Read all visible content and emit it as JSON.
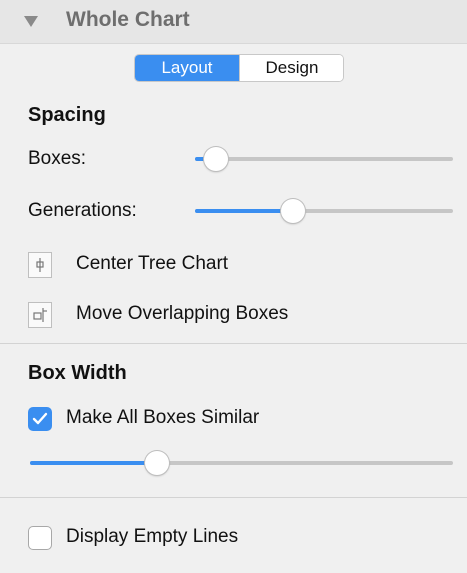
{
  "panel": {
    "title": "Whole Chart",
    "tabs": [
      {
        "label": "Layout",
        "active": true
      },
      {
        "label": "Design",
        "active": false
      }
    ]
  },
  "spacing": {
    "title": "Spacing",
    "boxes_label": "Boxes:",
    "boxes_value": 0.08,
    "generations_label": "Generations:",
    "generations_value": 0.38,
    "center_tree_label": "Center Tree Chart",
    "move_overlapping_label": "Move Overlapping Boxes"
  },
  "box_width": {
    "title": "Box Width",
    "make_similar_label": "Make All Boxes Similar",
    "make_similar_checked": true,
    "width_value": 0.3
  },
  "display_empty_lines": {
    "label": "Display Empty Lines",
    "checked": false
  },
  "colors": {
    "accent": "#3a8ef0",
    "track": "#c6c6c6",
    "background": "#f0f0f0",
    "header": "#e6e6e6"
  },
  "icons": {
    "header": "disclosure-triangle-icon",
    "center_tree": "center-tree-icon",
    "move_overlapping": "move-boxes-icon",
    "checkmark": "checkmark-icon"
  }
}
